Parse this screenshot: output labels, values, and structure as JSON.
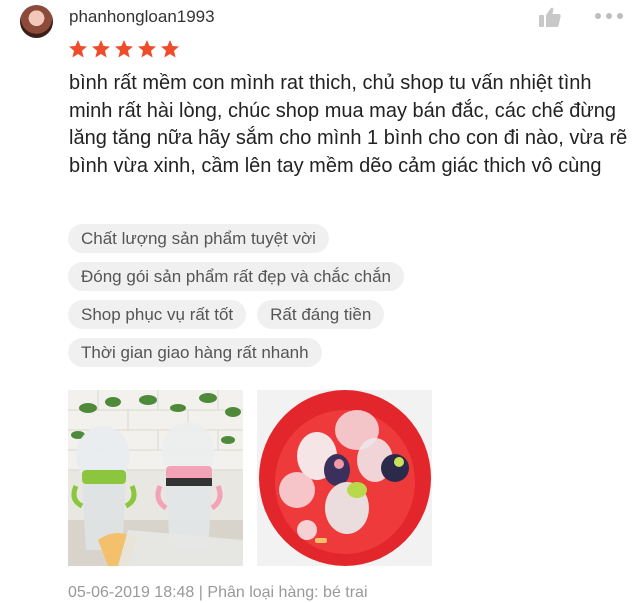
{
  "review": {
    "username": "phanhongloan1993",
    "rating": 5,
    "rating_max": 5,
    "text": "bình rất mềm con mình rat thich, chủ shop tu vấn nhiệt tình minh rất hài lòng, chúc shop mua may bán đắc, các chế đừng lăng tăng nữa hãy sắm cho mình 1 bình cho con đi nào, vừa rẽ bình vừa xinh, cầm lên tay mềm dẽo cảm giác thich vô cùng",
    "tags": [
      "Chất lượng sản phẩm tuyệt vời",
      "Đóng gói sản phẩm rất đẹp và chắc chắn",
      "Shop phục vụ rất tốt",
      "Rất đáng tiền",
      "Thời gian giao hàng rất nhanh"
    ],
    "date": "05-06-2019 18:48",
    "variation": "Phân loại hàng: bé trai"
  },
  "icons": [
    "avatar",
    "like-icon",
    "more-icon",
    "star-icon"
  ],
  "colors": {
    "star": "#ee4d2d",
    "tag_bg": "#f0f0f0",
    "meta": "#999999"
  }
}
